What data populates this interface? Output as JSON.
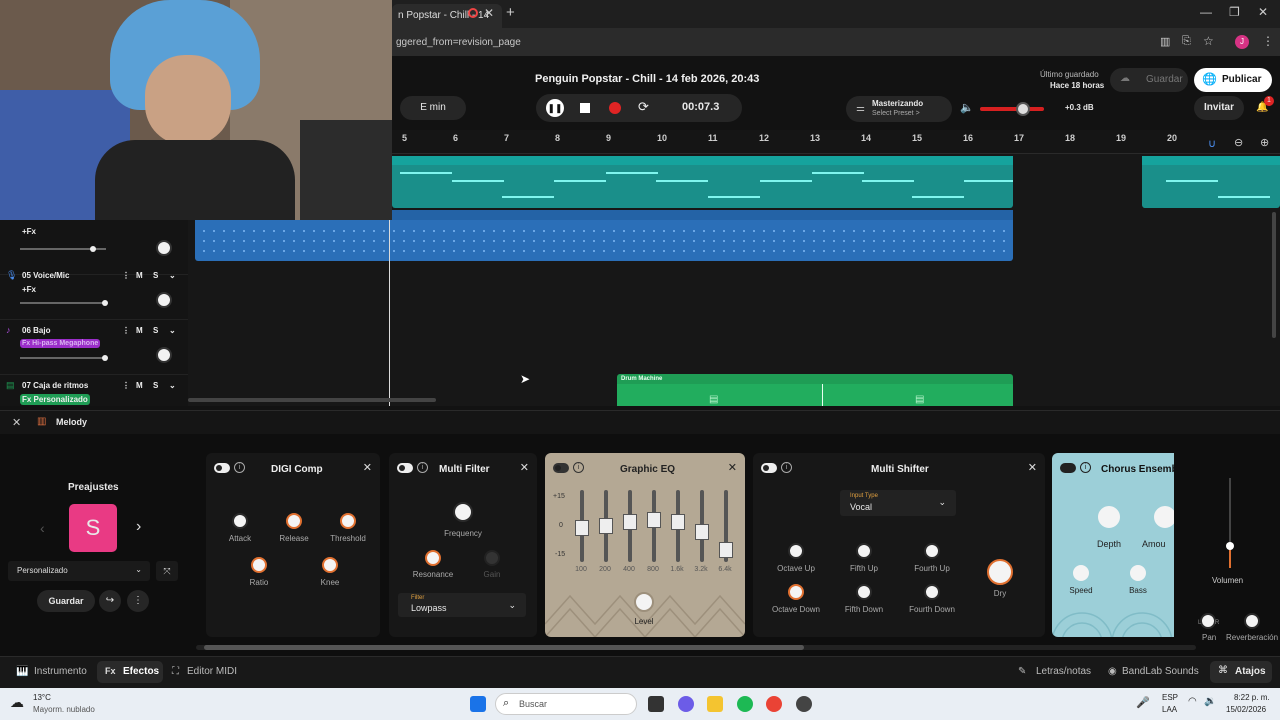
{
  "browser": {
    "tab_title": "n Popstar - Chill - 14",
    "url": "ggered_from=revision_page"
  },
  "header": {
    "project_title": "Penguin Popstar - Chill - 14 feb 2026, 20:43",
    "key": "E min",
    "time": "00:07.3",
    "mastering_title": "Masterizando",
    "mastering_preset": "Select Preset >",
    "volume_db": "+0.3 dB",
    "last_saved_label": "Último guardado",
    "last_saved_value": "Hace 18 horas",
    "save_label": "Guardar",
    "publish_label": "Publicar",
    "invite_label": "Invitar",
    "notif_count": "1"
  },
  "ruler": [
    "5",
    "6",
    "7",
    "8",
    "9",
    "10",
    "11",
    "12",
    "13",
    "14",
    "15",
    "16",
    "17",
    "18",
    "19",
    "20"
  ],
  "tracks": [
    {
      "num": "",
      "name": "",
      "fx": "+Fx",
      "fx_color": ""
    },
    {
      "num": "05",
      "name": "Voice/Mic",
      "fx": "+Fx",
      "fx_color": ""
    },
    {
      "num": "06",
      "name": "Bajo",
      "fx": "Fx Hi-pass Megaphone",
      "fx_color": "#9b2ec9"
    },
    {
      "num": "07",
      "name": "Caja de ritmos",
      "fx": "Fx Personalizado",
      "fx_color": "#1f9d55"
    }
  ],
  "clips": {
    "drum_label": "Drum Machine"
  },
  "panel": {
    "instrument_name": "Melody",
    "presets_title": "Preajustes",
    "preset_letter": "S",
    "preset_select": "Personalizado",
    "save_label": "Guardar"
  },
  "effects": {
    "digi_comp": {
      "title": "DIGI Comp",
      "knobs": [
        "Attack",
        "Release",
        "Threshold",
        "Ratio",
        "Knee"
      ]
    },
    "multi_filter": {
      "title": "Multi Filter",
      "knobs": [
        "Frequency",
        "Resonance",
        "Gain"
      ],
      "filter_label": "Filter",
      "filter_value": "Lowpass"
    },
    "graphic_eq": {
      "title": "Graphic EQ",
      "scale": [
        "+15",
        "0",
        "-15"
      ],
      "bands": [
        "100",
        "200",
        "400",
        "800",
        "1.6k",
        "3.2k",
        "6.4k"
      ],
      "level_label": "Level"
    },
    "multi_shifter": {
      "title": "Multi Shifter",
      "input_label": "Input Type",
      "input_value": "Vocal",
      "knobs": [
        "Octave Up",
        "Fifth Up",
        "Fourth Up",
        "Octave Down",
        "Fifth Down",
        "Fourth Down",
        "Dry"
      ]
    },
    "chorus": {
      "title": "Chorus Ensemble",
      "knobs": [
        "Depth",
        "Amou",
        "Speed",
        "Bass"
      ]
    }
  },
  "master": {
    "volume_label": "Volumen",
    "pan_label": "Pan",
    "reverb_label": "Reverberación",
    "pan_l": "L",
    "pan_r": "R"
  },
  "bottom_tabs": {
    "instrument": "Instrumento",
    "effects_prefix": "Fx",
    "effects": "Efectos",
    "midi": "Editor MIDI",
    "lyrics": "Letras/notas",
    "sounds": "BandLab Sounds",
    "shortcuts": "Atajos"
  },
  "taskbar": {
    "temp": "13°C",
    "weather": "Mayorm. nublado",
    "search": "Buscar",
    "lang": "ESP",
    "lang2": "LAA",
    "time": "8:22 p. m.",
    "date": "15/02/2026"
  }
}
